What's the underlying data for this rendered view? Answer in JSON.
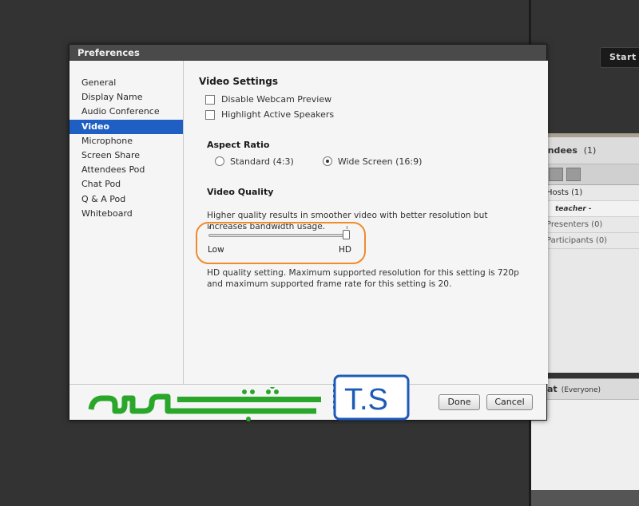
{
  "background": {
    "start_button": "Start M",
    "attendees": {
      "title": "tendees",
      "count": "(1)",
      "rows": [
        "Hosts (1)",
        "teacher -",
        "Presenters (0)",
        "Participants (0)"
      ]
    },
    "chat": {
      "title": "at",
      "scope": "(Everyone)"
    }
  },
  "dialog": {
    "title": "Preferences",
    "nav": [
      {
        "label": "General",
        "active": false
      },
      {
        "label": "Display Name",
        "active": false
      },
      {
        "label": "Audio Conference",
        "active": false
      },
      {
        "label": "Video",
        "active": true
      },
      {
        "label": "Microphone",
        "active": false
      },
      {
        "label": "Screen Share",
        "active": false
      },
      {
        "label": "Attendees Pod",
        "active": false
      },
      {
        "label": "Chat Pod",
        "active": false
      },
      {
        "label": "Q & A Pod",
        "active": false
      },
      {
        "label": "Whiteboard",
        "active": false
      }
    ],
    "video_settings": {
      "title": "Video Settings",
      "disable_preview": {
        "label": "Disable Webcam Preview",
        "checked": false
      },
      "highlight_speakers": {
        "label": "Highlight Active Speakers",
        "checked": false
      }
    },
    "aspect_ratio": {
      "title": "Aspect Ratio",
      "options": [
        {
          "label": "Standard (4:3)",
          "selected": false
        },
        {
          "label": "Wide Screen (16:9)",
          "selected": true
        }
      ]
    },
    "video_quality": {
      "title": "Video Quality",
      "description": "Higher quality results in smoother video with better resolution but increases bandwidth usage.",
      "slider": {
        "min_label": "Low",
        "max_label": "HD",
        "value": 1.0
      },
      "note": "HD quality setting. Maximum supported resolution for this setting is 720p and maximum supported frame rate for this setting is 20."
    },
    "buttons": {
      "done": "Done",
      "cancel": "Cancel"
    }
  },
  "watermark": {
    "persian_text": "تهران سرور",
    "logo_text": "T.S",
    "green": "#2aa62a",
    "blue": "#1e5bb8"
  },
  "colors": {
    "accent": "#1f5fc4",
    "highlight_ring": "#f08a2c"
  }
}
